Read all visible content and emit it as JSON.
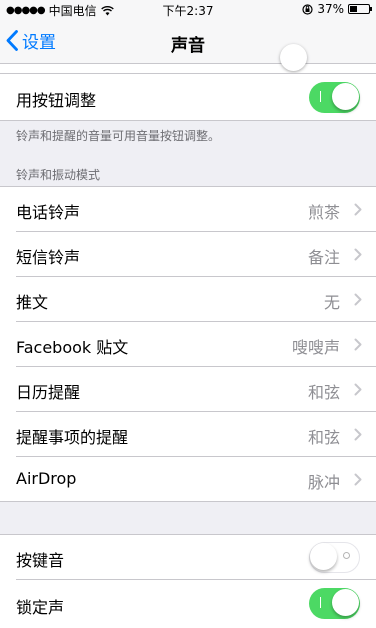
{
  "status_bar": {
    "carrier": "中国电信",
    "time": "下午2:37",
    "battery_percent": "37%",
    "battery_level": 0.37
  },
  "nav": {
    "back_label": "设置",
    "title": "声音"
  },
  "buttons_adjust": {
    "label": "用按钮调整",
    "on": true,
    "footer": "铃声和提醒的音量可用音量按钮调整。"
  },
  "ringtones_section": {
    "header": "铃声和振动模式",
    "items": [
      {
        "label": "电话铃声",
        "value": "煎茶"
      },
      {
        "label": "短信铃声",
        "value": "备注"
      },
      {
        "label": "推文",
        "value": "无"
      },
      {
        "label": "Facebook 贴文",
        "value": "嗖嗖声"
      },
      {
        "label": "日历提醒",
        "value": "和弦"
      },
      {
        "label": "提醒事项的提醒",
        "value": "和弦"
      },
      {
        "label": "AirDrop",
        "value": "脉冲"
      }
    ]
  },
  "keyboard_clicks": {
    "label": "按键音",
    "on": false
  },
  "lock_sound": {
    "label": "锁定声",
    "on": true
  }
}
